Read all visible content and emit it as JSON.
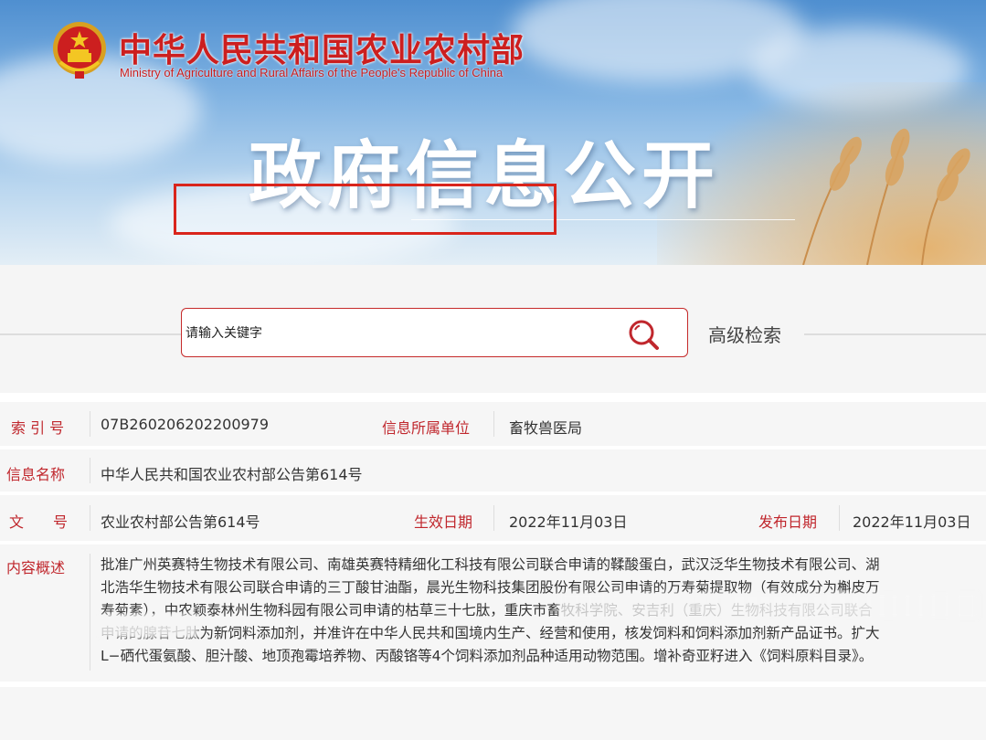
{
  "header": {
    "org_name_cn": "中华人民共和国农业农村部",
    "org_name_en": "Ministry of Agriculture and Rural Affairs of the People's Republic of China",
    "banner_title": "政府信息公开"
  },
  "search": {
    "placeholder": "请输入关键字",
    "advanced_label": "高级检索"
  },
  "info": {
    "index_label": "索 引 号",
    "index_value": "07B260206202200979",
    "dept_label": "信息所属单位",
    "dept_value": "畜牧兽医局",
    "name_label": "信息名称",
    "name_value": "中华人民共和国农业农村部公告第614号",
    "docno_label": "文　　号",
    "docno_value": "农业农村部公告第614号",
    "effective_label": "生效日期",
    "effective_value": "2022年11月03日",
    "publish_label": "发布日期",
    "publish_value": "2022年11月03日",
    "summary_label": "内容概述",
    "summary_text": "批准广州英赛特生物技术有限公司、南雄英赛特精细化工科技有限公司联合申请的鞣酸蛋白，武汉泛华生物技术有限公司、湖\n北浩华生物技术有限公司联合申请的三丁酸甘油酯，晨光生物科技集团股份有限公司申请的万寿菊提取物（有效成分为槲皮万\n寿菊素），中农颖泰林州生物科园有限公司申请的枯草三十七肽，重庆市畜牧科学院、安吉利（重庆）生物科技有限公司联合\n申请的腺苷七肽为新饲料添加剂，并准许在中华人民共和国境内生产、经营和使用，核发饲料和饲料添加剂新产品证书。扩大\nL−硒代蛋氨酸、胆汁酸、地顶孢霉培养物、丙酸铬等4个饲料添加剂品种适用动物范围。增补奇亚籽进入《饲料原料目录》。"
  },
  "colors": {
    "accent_red": "#c0272d",
    "highlight_red": "#d9251c",
    "banner_sky": "#7fb2e2"
  }
}
